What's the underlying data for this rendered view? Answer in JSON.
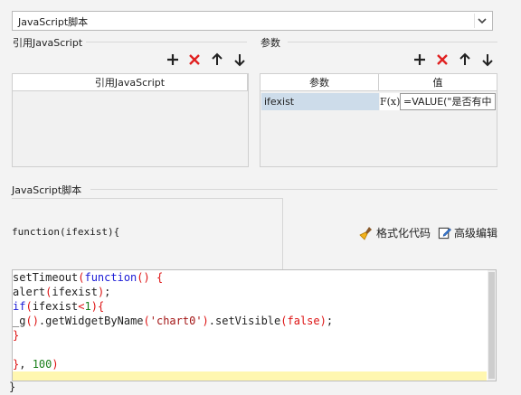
{
  "script_type_select": {
    "value": "JavaScript脚本"
  },
  "ref_js": {
    "title": "引用JavaScript",
    "column_header": "引用JavaScript"
  },
  "params": {
    "title": "参数",
    "columns": [
      "参数",
      "值"
    ],
    "rows": [
      {
        "name": "ifexist",
        "fx": "F(x)",
        "value": "=VALUE(\"是否有中"
      }
    ]
  },
  "script": {
    "title": "JavaScript脚本",
    "function_header": "function(ifexist){",
    "format_label": "格式化代码",
    "advanced_label": "高级编辑",
    "closing": "}"
  },
  "code_lines": [
    "setTimeout(function() {",
    "alert(ifexist);",
    "if(ifexist<1){",
    "_g().getWidgetByName('chart0').setVisible(false);",
    "}",
    "",
    "}, 100)"
  ],
  "icons": {
    "add": "plus-icon",
    "delete": "x-icon",
    "up": "arrow-up-icon",
    "down": "arrow-down-icon",
    "format": "broom-icon",
    "edit": "edit-icon"
  }
}
